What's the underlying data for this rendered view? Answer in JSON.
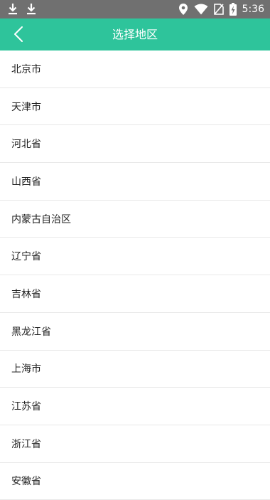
{
  "status_bar": {
    "time": "5:36",
    "left_icons": [
      "download-icon",
      "download-icon"
    ],
    "right_icons": [
      "location-icon",
      "wifi-icon",
      "no-sim-icon",
      "battery-charging-icon"
    ]
  },
  "app_bar": {
    "title": "选择地区",
    "back_icon": "chevron-left-icon",
    "background": "#2ec49b"
  },
  "regions": [
    "北京市",
    "天津市",
    "河北省",
    "山西省",
    "内蒙古自治区",
    "辽宁省",
    "吉林省",
    "黑龙江省",
    "上海市",
    "江苏省",
    "浙江省",
    "安徽省"
  ]
}
